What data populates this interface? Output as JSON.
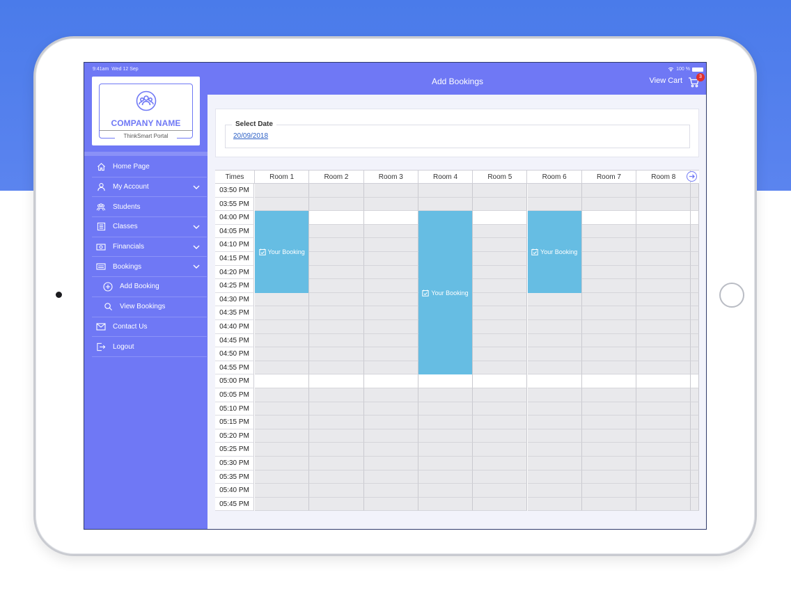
{
  "device": {
    "camera": "front-camera",
    "home_button": "home-button"
  },
  "status": {
    "time": "9:41am",
    "date": "Wed 12 Sep",
    "battery": "100 %"
  },
  "brand": {
    "company_name": "COMPANY NAME",
    "portal_name": "ThinkSmart Portal",
    "logo_icon": "people-group-icon"
  },
  "sidebar": {
    "items": [
      {
        "label": "Home Page",
        "icon": "home-icon",
        "has_chevron": false,
        "sub": false
      },
      {
        "label": "My Account",
        "icon": "user-icon",
        "has_chevron": true,
        "sub": false
      },
      {
        "label": "Students",
        "icon": "students-icon",
        "has_chevron": false,
        "sub": false
      },
      {
        "label": "Classes",
        "icon": "classes-icon",
        "has_chevron": true,
        "sub": false
      },
      {
        "label": "Financials",
        "icon": "money-icon",
        "has_chevron": true,
        "sub": false
      },
      {
        "label": "Bookings",
        "icon": "bookings-icon",
        "has_chevron": true,
        "sub": false
      },
      {
        "label": "Add Booking",
        "icon": "plus-circle-icon",
        "has_chevron": false,
        "sub": true
      },
      {
        "label": "View Bookings",
        "icon": "search-icon",
        "has_chevron": false,
        "sub": true
      },
      {
        "label": "Contact Us",
        "icon": "mail-icon",
        "has_chevron": false,
        "sub": false
      },
      {
        "label": "Logout",
        "icon": "logout-icon",
        "has_chevron": false,
        "sub": false
      }
    ]
  },
  "header": {
    "title": "Add Bookings",
    "view_cart_label": "View Cart",
    "cart_count": "3"
  },
  "date_picker": {
    "label": "Select Date",
    "value": "20/09/2018"
  },
  "schedule": {
    "times_header": "Times",
    "rooms": [
      "Room 1",
      "Room 2",
      "Room 3",
      "Room 4",
      "Room 5",
      "Room 6",
      "Room 7",
      "Room 8"
    ],
    "times": [
      "03:50 PM",
      "03:55 PM",
      "04:00 PM",
      "04:05 PM",
      "04:10 PM",
      "04:15 PM",
      "04:20 PM",
      "04:25 PM",
      "04:30 PM",
      "04:35 PM",
      "04:40 PM",
      "04:45 PM",
      "04:50 PM",
      "04:55 PM",
      "05:00 PM",
      "05:05 PM",
      "05:10 PM",
      "05:15 PM",
      "05:20 PM",
      "05:25 PM",
      "05:30 PM",
      "05:35 PM",
      "05:40 PM",
      "05:45 PM"
    ],
    "available_slots": [
      "04:00 PM",
      "05:00 PM"
    ],
    "bookings": [
      {
        "room": "Room 1",
        "start": "04:00 PM",
        "end": "04:25 PM",
        "label": "Your Booking"
      },
      {
        "room": "Room 4",
        "start": "04:00 PM",
        "end": "04:55 PM",
        "label": "Your Booking"
      },
      {
        "room": "Room 6",
        "start": "04:00 PM",
        "end": "04:25 PM",
        "label": "Your Booking"
      }
    ],
    "next_icon": "arrow-right-icon"
  },
  "colors": {
    "accent": "#6f78f5",
    "booking": "#66bde3",
    "badge": "#e0302e",
    "background_top": "#4a7bea"
  }
}
